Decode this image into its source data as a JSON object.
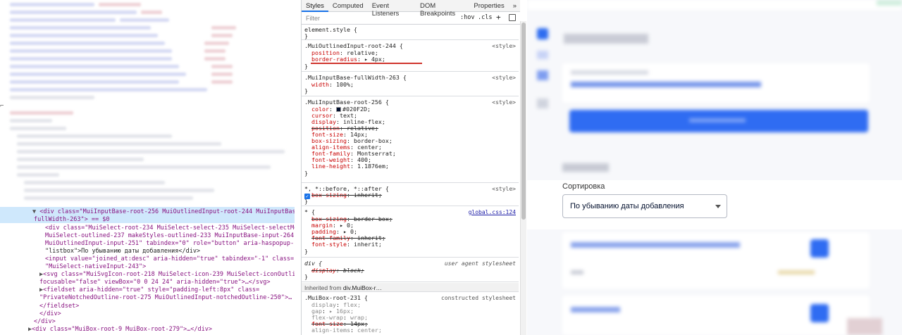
{
  "styles_panel": {
    "tabs": [
      "Styles",
      "Computed",
      "Event Listeners",
      "DOM Breakpoints",
      "Properties",
      "»"
    ],
    "active_tab": "Styles",
    "filter_placeholder": "Filter",
    "hov_label": ":hov",
    "cls_label": ".cls",
    "plus_label": "+",
    "rules": {
      "element_style": {
        "selector": "element.style {",
        "close": "}"
      },
      "outlined_root": {
        "selector": ".MuiOutlinedInput-root-244 {",
        "source": "<style>",
        "props": [
          {
            "name": "position",
            "value": "relative;"
          },
          {
            "name": "border-radius",
            "value": "▸ 4px;"
          }
        ],
        "close": "}"
      },
      "full_width": {
        "selector": ".MuiInputBase-fullWidth-263 {",
        "source": "<style>",
        "props": [
          {
            "name": "width",
            "value": "100%;"
          }
        ],
        "close": "}"
      },
      "base_root": {
        "selector": ".MuiInputBase-root-256 {",
        "source": "<style>",
        "props": [
          {
            "name": "color",
            "value": "#020F2D;"
          },
          {
            "name": "cursor",
            "value": "text;"
          },
          {
            "name": "display",
            "value": "inline-flex;"
          },
          {
            "name": "position",
            "value": "relative;"
          },
          {
            "name": "font-size",
            "value": "14px;"
          },
          {
            "name": "box-sizing",
            "value": "border-box;"
          },
          {
            "name": "align-items",
            "value": "center;"
          },
          {
            "name": "font-family",
            "value": "Montserrat;"
          },
          {
            "name": "font-weight",
            "value": "400;"
          },
          {
            "name": "line-height",
            "value": "1.1876em;"
          }
        ],
        "close": "}"
      },
      "pseudo": {
        "selector": "*, *::before, *::after {",
        "source": "<style>",
        "props": [
          {
            "name": "box-sizing",
            "value": "inherit;"
          }
        ],
        "close": "}"
      },
      "global": {
        "selector": "* {",
        "source": "global.css:124",
        "props": [
          {
            "name": "box-sizing",
            "value": "border-box;"
          },
          {
            "name": "margin",
            "value": "▸ 0;"
          },
          {
            "name": "padding",
            "value": "▸ 0;"
          },
          {
            "name": "font-family",
            "value": "inherit;"
          },
          {
            "name": "font-style",
            "value": "inherit;"
          }
        ],
        "close": "}"
      },
      "ua_div": {
        "selector": "div {",
        "source": "user agent stylesheet",
        "props": [
          {
            "name": "display",
            "value": "block;"
          }
        ],
        "close": "}"
      },
      "inherited_label": "Inherited from",
      "inherited_from": "div.MuiBox-r…",
      "box_root": {
        "selector": ".MuiBox-root-231 {",
        "source": "constructed stylesheet",
        "props": [
          {
            "name": "display",
            "value": "flex;"
          },
          {
            "name": "gap",
            "value": "▸ 16px;"
          },
          {
            "name": "flex-wrap",
            "value": "wrap;"
          },
          {
            "name": "font-size",
            "value": "14px;"
          },
          {
            "name": "align-items",
            "value": "center;"
          }
        ]
      }
    }
  },
  "dom_tree": {
    "lines": [
      {
        "tri": "▼",
        "html": "<div class=\"MuiInputBase-root-256 MuiOutlinedInput-root-244 MuiInputBase-"
      },
      {
        "tri": "",
        "html": "fullWidth-263\"> == $0"
      },
      {
        "tri": "",
        "html": "<div class=\"MuiSelect-root-234 MuiSelect-select-235 MuiSelect-selectMenu-238"
      },
      {
        "tri": "",
        "html": "MuiSelect-outlined-237 makeStyles-outlined-233 MuiInputBase-input-264"
      },
      {
        "tri": "",
        "html": "MuiOutlinedInput-input-251\" tabindex=\"0\" role=\"button\" aria-haspopup-"
      },
      {
        "tri": "",
        "html": "\"listbox\">По убыванию даты добавления</div>"
      },
      {
        "tri": "",
        "html": "<input value=\"joined_at:desc\" aria-hidden=\"true\" tabindex=\"-1\" class="
      },
      {
        "tri": "",
        "html": "\"MuiSelect-nativeInput-243\">"
      },
      {
        "tri": "▶",
        "html": "<svg class=\"MuiSvgIcon-root-218 MuiSelect-icon-239 MuiSelect-iconOutlined-242\""
      },
      {
        "tri": "",
        "html": "focusable=\"false\" viewBox=\"0 0 24 24\" aria-hidden=\"true\">…</svg>"
      },
      {
        "tri": "▶",
        "html": "<fieldset aria-hidden=\"true\" style=\"padding-left:8px\" class="
      },
      {
        "tri": "",
        "html": "\"PrivateNotchedOutline-root-275 MuiOutlinedInput-notchedOutline-250\">…"
      },
      {
        "tri": "",
        "html": "</fieldset>"
      },
      {
        "tri": "",
        "html": "</div>"
      },
      {
        "tri": "",
        "html": "</div>"
      },
      {
        "tri": "▶",
        "html": "<div class=\"MuiBox-root-9 MuiBox-root-279\">…</div>"
      }
    ]
  },
  "app_preview": {
    "sort_label": "Сортировка",
    "sort_value": "По убыванию даты добавления"
  }
}
